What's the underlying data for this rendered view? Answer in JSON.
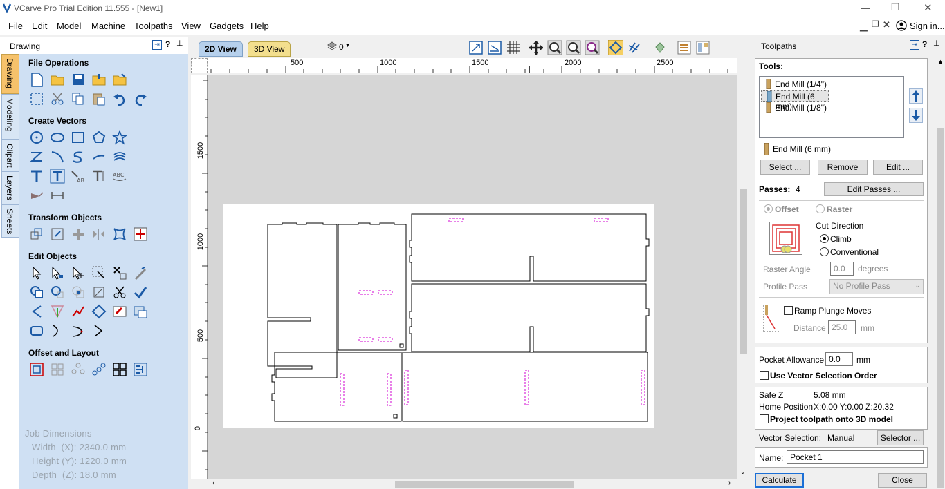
{
  "window": {
    "title": "VCarve Pro Trial Edition 11.555 - [New1]",
    "min": "—",
    "restore": "❐",
    "close": "✕"
  },
  "menu": {
    "items": [
      "File",
      "Edit",
      "Model",
      "Machine",
      "Toolpaths",
      "View",
      "Gadgets",
      "Help"
    ],
    "signin": "Sign in..."
  },
  "left": {
    "title": "Drawing",
    "tabs": [
      "Drawing",
      "Modeling",
      "Clipart",
      "Layers",
      "Sheets"
    ],
    "sections": [
      "File Operations",
      "Create Vectors",
      "Transform Objects",
      "Edit Objects",
      "Offset and Layout"
    ],
    "job": {
      "title": "Job Dimensions",
      "width": "Width  (X): 2340.0 mm",
      "height": "Height (Y): 1220.0 mm",
      "depth": "Depth  (Z): 18.0 mm"
    }
  },
  "view": {
    "tab2d": "2D View",
    "tab3d": "3D View",
    "layer": "0",
    "hticks": [
      "500",
      "1000",
      "1500",
      "2000",
      "2500"
    ],
    "vticks": [
      "1500",
      "1000",
      "500",
      "0"
    ]
  },
  "toolpaths": {
    "title": "Toolpaths",
    "tools_label": "Tools:",
    "tools": [
      "End Mill (1/4\")",
      "End Mill (6 mm)",
      "End Mill (1/8\")"
    ],
    "selected_tool": "End Mill (6 mm)",
    "select": "Select ...",
    "remove": "Remove",
    "edit": "Edit ...",
    "passes_label": "Passes:",
    "passes": "4",
    "edit_passes": "Edit Passes ...",
    "offset": "Offset",
    "raster": "Raster",
    "cut_direction": "Cut Direction",
    "climb": "Climb",
    "conventional": "Conventional",
    "raster_angle": "Raster Angle",
    "raster_angle_val": "0.0",
    "degrees": "degrees",
    "profile_pass": "Profile Pass",
    "profile_pass_val": "No Profile Pass",
    "ramp": "Ramp Plunge Moves",
    "distance": "Distance",
    "distance_val": "25.0",
    "mm": "mm",
    "pocket_allowance": "Pocket Allowance",
    "pocket_allowance_val": "0.0",
    "use_vector_order": "Use Vector Selection Order",
    "safe_z": "Safe Z",
    "safe_z_val": "5.08 mm",
    "home": "Home Position",
    "home_val": "X:0.00 Y:0.00 Z:20.32",
    "project": "Project toolpath onto 3D model",
    "vector_sel": "Vector Selection:",
    "vector_sel_val": "Manual",
    "selector": "Selector ...",
    "name": "Name:",
    "name_val": "Pocket 1",
    "calculate": "Calculate",
    "close": "Close"
  }
}
